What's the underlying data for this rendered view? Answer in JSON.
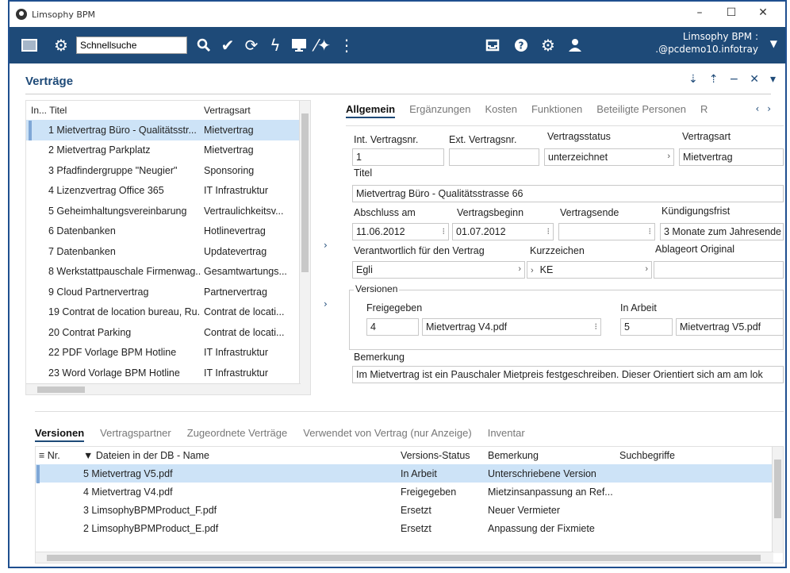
{
  "window": {
    "title": "Limsophy BPM",
    "minimize": "–",
    "maximize": "☐",
    "close": "✕"
  },
  "toolbar": {
    "search_value": "Schnellsuche",
    "user_line1": "Limsophy BPM :",
    "user_line2": ".@pcdemo10.infotray"
  },
  "page": {
    "title": "Verträge",
    "actions": [
      "⇣",
      "⇡",
      "−",
      "✕",
      "▾"
    ]
  },
  "left_table": {
    "headers": [
      "In... Titel",
      "Vertragsart"
    ],
    "rows": [
      [
        "1 Mietvertrag Büro - Qualitätsstr...",
        "Mietvertrag"
      ],
      [
        "2 Mietvertrag Parkplatz",
        "Mietvertrag"
      ],
      [
        "3 Pfadfindergruppe \"Neugier\"",
        "Sponsoring"
      ],
      [
        "4 Lizenzvertrag Office 365",
        "IT Infrastruktur"
      ],
      [
        "5 Geheimhaltungsvereinbarung",
        "Vertraulichkeitsv..."
      ],
      [
        "6 Datenbanken",
        "Hotlinevertrag"
      ],
      [
        "7 Datenbanken",
        "Updatevertrag"
      ],
      [
        "8 Werkstattpauschale Firmenwag...",
        "Gesamtwartungs..."
      ],
      [
        "9 Cloud Partnervertrag",
        "Partnervertrag"
      ],
      [
        "19 Contrat de location bureau, Ru...",
        "Contrat de locati..."
      ],
      [
        "20 Contrat Parking",
        "Contrat de locati..."
      ],
      [
        "22 PDF Vorlage BPM Hotline",
        "IT Infrastruktur"
      ],
      [
        "23 Word Vorlage BPM Hotline",
        "IT Infrastruktur"
      ]
    ]
  },
  "detail_tabs": [
    "Allgemein",
    "Ergänzungen",
    "Kosten",
    "Funktionen",
    "Beteiligte Personen",
    "R"
  ],
  "detail": {
    "int_nr_label": "Int. Vertragsnr.",
    "int_nr": "1",
    "ext_nr_label": "Ext. Vertragsnr.",
    "ext_nr": "",
    "status_label": "Vertragsstatus",
    "status": "unterzeichnet",
    "art_label": "Vertragsart",
    "art": "Mietvertrag",
    "titel_label": "Titel",
    "titel": "Mietvertrag Büro - Qualitätsstrasse 66",
    "abschluss_label": "Abschluss am",
    "abschluss": "11.06.2012",
    "beginn_label": "Vertragsbeginn",
    "beginn": "01.07.2012",
    "ende_label": "Vertragsende",
    "ende": "",
    "kuendigung_label": "Kündigungsfrist",
    "kuendigung": "3 Monate zum Jahresende",
    "verantwortlich_label": "Verantwortlich für den Vertrag",
    "verantwortlich": "Egli",
    "kurz_label": "Kurzzeichen",
    "kurz": "KE",
    "ablage_label": "Ablageort Original",
    "ablage": "",
    "versionen_label": "Versionen",
    "freigegeben_label": "Freigegeben",
    "freigegeben_nr": "4",
    "freigegeben_file": "Mietvertrag V4.pdf",
    "inarbeit_label": "In Arbeit",
    "inarbeit_nr": "5",
    "inarbeit_file": "Mietvertrag V5.pdf",
    "bemerkung_label": "Bemerkung",
    "bemerkung": "Im Mietvertrag ist ein Pauschaler Mietpreis festgeschreiben. Dieser Orientiert sich am am lok"
  },
  "bottom_tabs": [
    "Versionen",
    "Vertragspartner",
    "Zugeordnete Verträge",
    "Verwendet von Vertrag (nur Anzeige)",
    "Inventar"
  ],
  "bottom_table": {
    "headers": [
      "≡ Nr.",
      "▼ Dateien in der DB - Name",
      "Versions-Status",
      "Bemerkung",
      "Suchbegriffe"
    ],
    "rows": [
      [
        "",
        "5 Mietvertrag V5.pdf",
        "In Arbeit",
        "Unterschriebene Version",
        ""
      ],
      [
        "",
        "4 Mietvertrag V4.pdf",
        "Freigegeben",
        "Mietzinsanpassung an Ref...",
        ""
      ],
      [
        "",
        "3 LimsophyBPMProduct_F.pdf",
        "Ersetzt",
        "Neuer Vermieter",
        ""
      ],
      [
        "",
        "2 LimsophyBPMProduct_E.pdf",
        "Ersetzt",
        "Anpassung der Fixmiete",
        ""
      ]
    ]
  }
}
